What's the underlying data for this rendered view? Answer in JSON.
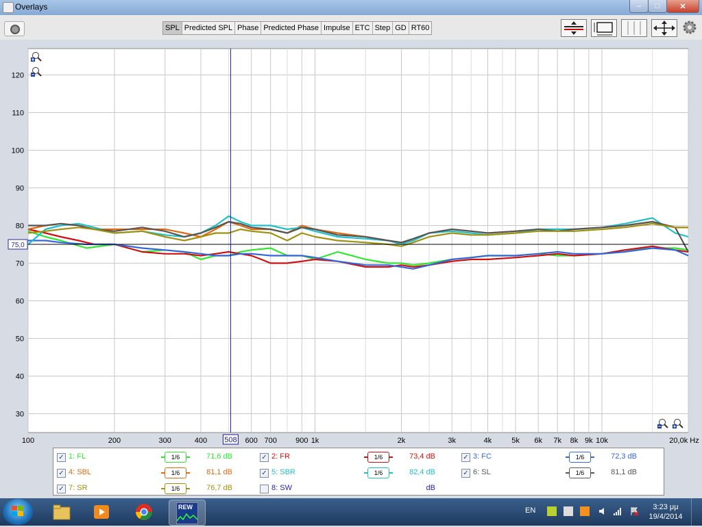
{
  "window": {
    "title": "Overlays",
    "minimize": "–",
    "maximize": "□",
    "close": "✕"
  },
  "tabs": [
    "SPL",
    "Predicted SPL",
    "Phase",
    "Predicted Phase",
    "Impulse",
    "ETC",
    "Step",
    "GD",
    "RT60"
  ],
  "active_tab": "SPL",
  "icons": {
    "capture": "camera-icon",
    "zoom_in": "magnifier-plus-icon",
    "zoom_out": "magnifier-minus-icon",
    "controls": [
      "vertical-resize-icon",
      "window-limits-icon",
      "grid-icon",
      "move-arrows-icon",
      "gear-icon"
    ]
  },
  "chart_data": {
    "type": "line",
    "ylabel": "dB",
    "ylim": [
      25,
      127
    ],
    "xlim": [
      100,
      20000
    ],
    "x_scale": "log",
    "grid": true,
    "y_ticks": [
      30,
      40,
      50,
      60,
      70,
      80,
      90,
      100,
      110,
      120
    ],
    "x_ticks": [
      {
        "v": 100,
        "label": "100"
      },
      {
        "v": 200,
        "label": "200"
      },
      {
        "v": 300,
        "label": "300"
      },
      {
        "v": 400,
        "label": "400"
      },
      {
        "v": 600,
        "label": "600"
      },
      {
        "v": 700,
        "label": "700"
      },
      {
        "v": 900,
        "label": "900"
      },
      {
        "v": 1000,
        "label": "1k"
      },
      {
        "v": 2000,
        "label": "2k"
      },
      {
        "v": 3000,
        "label": "3k"
      },
      {
        "v": 4000,
        "label": "4k"
      },
      {
        "v": 5000,
        "label": "5k"
      },
      {
        "v": 6000,
        "label": "6k"
      },
      {
        "v": 7000,
        "label": "7k"
      },
      {
        "v": 8000,
        "label": "8k"
      },
      {
        "v": 9000,
        "label": "9k"
      },
      {
        "v": 10000,
        "label": "10k"
      },
      {
        "v": 20000,
        "label": "20,0k Hz"
      }
    ],
    "minor_x": [
      500,
      800,
      1500,
      2500,
      3500,
      4500,
      15000
    ],
    "cursor": {
      "x": 508,
      "label": "508"
    },
    "reference": {
      "y": 75.0,
      "label": "75,0"
    },
    "series": [
      {
        "name": "FL",
        "color": "#2ee82e",
        "points": [
          [
            100,
            78.5
          ],
          [
            115,
            77
          ],
          [
            130,
            76
          ],
          [
            160,
            74
          ],
          [
            200,
            75
          ],
          [
            250,
            73
          ],
          [
            300,
            73.5
          ],
          [
            350,
            73
          ],
          [
            400,
            71
          ],
          [
            450,
            72
          ],
          [
            500,
            72
          ],
          [
            550,
            73
          ],
          [
            600,
            73.5
          ],
          [
            700,
            74
          ],
          [
            800,
            72
          ],
          [
            900,
            72
          ],
          [
            1000,
            71
          ],
          [
            1200,
            73
          ],
          [
            1500,
            71
          ],
          [
            1800,
            70
          ],
          [
            2000,
            70
          ],
          [
            2200,
            69.5
          ],
          [
            2500,
            70
          ],
          [
            3000,
            71
          ],
          [
            3500,
            71.5
          ],
          [
            4000,
            72
          ],
          [
            5000,
            72
          ],
          [
            6000,
            72.5
          ],
          [
            7000,
            72
          ],
          [
            8000,
            72
          ],
          [
            10000,
            72.5
          ],
          [
            12000,
            73.5
          ],
          [
            15000,
            74
          ],
          [
            18000,
            74
          ],
          [
            20000,
            73.5
          ]
        ]
      },
      {
        "name": "FR",
        "color": "#d01010",
        "points": [
          [
            100,
            79
          ],
          [
            115,
            78
          ],
          [
            130,
            77
          ],
          [
            150,
            76
          ],
          [
            170,
            75
          ],
          [
            200,
            75
          ],
          [
            250,
            73
          ],
          [
            300,
            72.5
          ],
          [
            350,
            72.5
          ],
          [
            400,
            72
          ],
          [
            450,
            72.5
          ],
          [
            500,
            73
          ],
          [
            550,
            72.5
          ],
          [
            600,
            72
          ],
          [
            650,
            71
          ],
          [
            700,
            70
          ],
          [
            800,
            70
          ],
          [
            900,
            70.5
          ],
          [
            1000,
            71
          ],
          [
            1200,
            70.5
          ],
          [
            1500,
            69
          ],
          [
            1800,
            69
          ],
          [
            2000,
            69.5
          ],
          [
            2200,
            69
          ],
          [
            2500,
            69.5
          ],
          [
            3000,
            70.5
          ],
          [
            3500,
            71
          ],
          [
            4000,
            71
          ],
          [
            5000,
            71.5
          ],
          [
            6000,
            72
          ],
          [
            7000,
            72.5
          ],
          [
            8000,
            72
          ],
          [
            10000,
            72.5
          ],
          [
            12000,
            73.5
          ],
          [
            15000,
            74.5
          ],
          [
            18000,
            73.5
          ],
          [
            20000,
            73
          ]
        ]
      },
      {
        "name": "FC",
        "color": "#3366dd",
        "points": [
          [
            100,
            76
          ],
          [
            115,
            76
          ],
          [
            130,
            75.5
          ],
          [
            160,
            75
          ],
          [
            200,
            75
          ],
          [
            250,
            74
          ],
          [
            300,
            73.5
          ],
          [
            350,
            73
          ],
          [
            400,
            72.5
          ],
          [
            450,
            72
          ],
          [
            500,
            72
          ],
          [
            550,
            72.5
          ],
          [
            600,
            72.5
          ],
          [
            700,
            72
          ],
          [
            800,
            72
          ],
          [
            900,
            72
          ],
          [
            1000,
            71.5
          ],
          [
            1200,
            70.5
          ],
          [
            1500,
            69.5
          ],
          [
            1800,
            69.5
          ],
          [
            2000,
            69
          ],
          [
            2200,
            68.5
          ],
          [
            2500,
            69.5
          ],
          [
            3000,
            71
          ],
          [
            3500,
            71.5
          ],
          [
            4000,
            72
          ],
          [
            5000,
            72
          ],
          [
            6000,
            72.5
          ],
          [
            7000,
            73
          ],
          [
            8000,
            72.5
          ],
          [
            10000,
            72.5
          ],
          [
            12000,
            73
          ],
          [
            15000,
            74
          ],
          [
            18000,
            73.5
          ],
          [
            20000,
            72
          ]
        ]
      },
      {
        "name": "SBL",
        "color": "#e06a10",
        "points": [
          [
            100,
            79
          ],
          [
            115,
            80
          ],
          [
            130,
            80.5
          ],
          [
            150,
            80
          ],
          [
            170,
            79
          ],
          [
            200,
            79
          ],
          [
            250,
            79
          ],
          [
            300,
            79
          ],
          [
            350,
            78
          ],
          [
            400,
            77
          ],
          [
            450,
            79
          ],
          [
            500,
            81
          ],
          [
            550,
            80
          ],
          [
            600,
            79
          ],
          [
            700,
            79
          ],
          [
            800,
            78
          ],
          [
            900,
            80
          ],
          [
            1000,
            79
          ],
          [
            1200,
            78
          ],
          [
            1500,
            77
          ],
          [
            1800,
            76
          ],
          [
            2000,
            75.5
          ],
          [
            2200,
            76
          ],
          [
            2500,
            78
          ],
          [
            3000,
            79
          ],
          [
            3500,
            78.5
          ],
          [
            4000,
            78
          ],
          [
            5000,
            78.5
          ],
          [
            6000,
            79
          ],
          [
            7000,
            79
          ],
          [
            8000,
            79
          ],
          [
            10000,
            79.5
          ],
          [
            12000,
            80
          ],
          [
            15000,
            81
          ],
          [
            18000,
            79.5
          ],
          [
            20000,
            79.5
          ]
        ]
      },
      {
        "name": "SBR",
        "color": "#20c0c8",
        "points": [
          [
            100,
            75
          ],
          [
            115,
            79
          ],
          [
            130,
            80
          ],
          [
            150,
            80.5
          ],
          [
            170,
            79.5
          ],
          [
            200,
            78
          ],
          [
            250,
            78.5
          ],
          [
            300,
            77.5
          ],
          [
            350,
            77
          ],
          [
            400,
            78
          ],
          [
            450,
            80
          ],
          [
            500,
            82.5
          ],
          [
            550,
            81
          ],
          [
            600,
            80
          ],
          [
            700,
            80
          ],
          [
            800,
            79
          ],
          [
            900,
            79.5
          ],
          [
            1000,
            78.5
          ],
          [
            1200,
            77
          ],
          [
            1500,
            76.5
          ],
          [
            1800,
            76
          ],
          [
            2000,
            75
          ],
          [
            2200,
            76
          ],
          [
            2500,
            78
          ],
          [
            3000,
            78.5
          ],
          [
            3500,
            78
          ],
          [
            4000,
            77.5
          ],
          [
            5000,
            78
          ],
          [
            6000,
            79
          ],
          [
            7000,
            79
          ],
          [
            8000,
            79
          ],
          [
            10000,
            79.5
          ],
          [
            12000,
            80.5
          ],
          [
            15000,
            82
          ],
          [
            18000,
            78
          ],
          [
            20000,
            77
          ]
        ]
      },
      {
        "name": "SL",
        "color": "#555555",
        "points": [
          [
            100,
            80
          ],
          [
            115,
            80
          ],
          [
            130,
            80.5
          ],
          [
            150,
            80
          ],
          [
            170,
            79
          ],
          [
            200,
            78.5
          ],
          [
            250,
            79.5
          ],
          [
            300,
            78.5
          ],
          [
            350,
            77
          ],
          [
            400,
            78
          ],
          [
            450,
            79.5
          ],
          [
            500,
            81
          ],
          [
            550,
            80.5
          ],
          [
            600,
            79.5
          ],
          [
            700,
            79
          ],
          [
            800,
            78
          ],
          [
            900,
            79.5
          ],
          [
            1000,
            79
          ],
          [
            1200,
            77.5
          ],
          [
            1500,
            77
          ],
          [
            1800,
            76
          ],
          [
            2000,
            75.5
          ],
          [
            2200,
            76.5
          ],
          [
            2500,
            78
          ],
          [
            3000,
            79
          ],
          [
            3500,
            78.5
          ],
          [
            4000,
            78
          ],
          [
            5000,
            78.5
          ],
          [
            6000,
            79
          ],
          [
            7000,
            78.5
          ],
          [
            8000,
            79
          ],
          [
            10000,
            79.5
          ],
          [
            12000,
            80
          ],
          [
            15000,
            81
          ],
          [
            18000,
            79.5
          ],
          [
            20000,
            73
          ]
        ]
      },
      {
        "name": "SR",
        "color": "#a09010",
        "points": [
          [
            100,
            78
          ],
          [
            115,
            78.5
          ],
          [
            130,
            79
          ],
          [
            150,
            79.5
          ],
          [
            170,
            79
          ],
          [
            200,
            78
          ],
          [
            250,
            78.5
          ],
          [
            300,
            77
          ],
          [
            350,
            76
          ],
          [
            400,
            77
          ],
          [
            450,
            78
          ],
          [
            500,
            78
          ],
          [
            550,
            79
          ],
          [
            600,
            78.5
          ],
          [
            700,
            78
          ],
          [
            800,
            76
          ],
          [
            900,
            78
          ],
          [
            1000,
            77
          ],
          [
            1200,
            76
          ],
          [
            1500,
            75.5
          ],
          [
            1800,
            75
          ],
          [
            2000,
            74.5
          ],
          [
            2200,
            75.5
          ],
          [
            2500,
            77
          ],
          [
            3000,
            78
          ],
          [
            3500,
            77.5
          ],
          [
            4000,
            77.5
          ],
          [
            5000,
            78
          ],
          [
            6000,
            78.5
          ],
          [
            7000,
            78.5
          ],
          [
            8000,
            78.5
          ],
          [
            10000,
            79
          ],
          [
            12000,
            79.5
          ],
          [
            15000,
            80.5
          ],
          [
            18000,
            79.5
          ],
          [
            20000,
            79.5
          ]
        ]
      }
    ]
  },
  "legend": [
    [
      {
        "id": "1",
        "label": "1: FL",
        "checked": true,
        "smoothing": "1/6",
        "value": "71,6 dB",
        "color": "#2ee82e"
      },
      {
        "id": "2",
        "label": "2: FR",
        "checked": true,
        "smoothing": "1/6",
        "value": "73,4 dB",
        "color": "#d01010"
      },
      {
        "id": "3",
        "label": "3: FC",
        "checked": true,
        "smoothing": "1/6",
        "value": "72,3 dB",
        "color": "#3366dd"
      }
    ],
    [
      {
        "id": "4",
        "label": "4: SBL",
        "checked": true,
        "smoothing": "1/6",
        "value": "81,1 dB",
        "color": "#e06a10"
      },
      {
        "id": "5",
        "label": "5: SBR",
        "checked": true,
        "smoothing": "1/6",
        "value": "82,4 dB",
        "color": "#20c0c8"
      },
      {
        "id": "6",
        "label": "6: SL",
        "checked": true,
        "smoothing": "1/6",
        "value": "81,1 dB",
        "color": "#555555"
      }
    ],
    [
      {
        "id": "7",
        "label": "7: SR",
        "checked": true,
        "smoothing": "1/6",
        "value": "76,7 dB",
        "color": "#a09010"
      },
      {
        "id": "8",
        "label": "8: SW",
        "checked": false,
        "smoothing": "",
        "value": "dB",
        "color": "#2222aa"
      }
    ]
  ],
  "taskbar": {
    "apps": [
      {
        "name": "explorer",
        "icon": "folder-icon",
        "active": false
      },
      {
        "name": "media",
        "icon": "media-player-icon",
        "active": false
      },
      {
        "name": "chrome",
        "icon": "chrome-icon",
        "active": false
      },
      {
        "name": "rew",
        "icon": "rew-icon",
        "active": true,
        "label": "REW"
      }
    ],
    "lang": "EN",
    "time": "3:23 μμ",
    "date": "19/4/2014"
  }
}
